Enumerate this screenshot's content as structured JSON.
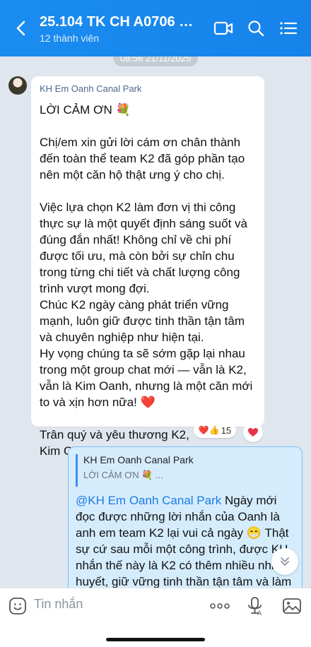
{
  "header": {
    "title": "25.104 TK CH A0706 Ca...",
    "subtitle": "12 thành viên",
    "icons": [
      "back-icon",
      "video-call-icon",
      "search-icon",
      "menu-list-icon"
    ],
    "bg_color": "#1a8cf0"
  },
  "chat": {
    "timestamp": "08:56 21/11/2025",
    "incoming": {
      "sender": "KH Em Oanh Canal Park",
      "text": "LỜI CẢM ƠN 💐\n\nChị/em xin gửi lời cám ơn chân thành đến toàn thể team K2 đã góp phần tạo nên một căn hộ thật ưng ý cho chị.\n\nViệc lựa chọn K2 làm đơn vị thi công thực sự là một quyết định sáng suốt và đúng đắn nhất! Không chỉ về chi phí được tối ưu, mà còn bởi sự chỉn chu trong từng chi tiết và chất lượng công trình vượt mong đợi.\nChúc K2 ngày càng phát triển vững mạnh, luôn giữ được tinh thần tận tâm và chuyên nghiệp như hiện tại.\nHy vọng chúng ta sẽ sớm gặp lại nhau trong một group chat mới — vẫn là K2, vẫn là Kim Oanh, nhưng là một căn mới to và xịn hơn nữa! ❤️\n\nTrân quý và yêu thương K2,\nKim Oanh",
      "reactions_emoji": "❤️👍",
      "reactions_count": "15"
    },
    "outgoing": {
      "quote_name": "KH Em Oanh Canal Park",
      "quote_text": "LỜI CẢM ƠN 💐 ...",
      "mention": "@KH Em Oanh Canal Park",
      "text": " Ngày mới đọc được những lời nhắn của Oanh là anh em team K2 lại vui cả ngày 😁 Thật sự cứ sau mỗi một công trình, được KH nhắn thế này là K2 có thêm nhiều nhiệt huyết, giữ vững tinh thần tận tâm và làm tốt hơn mỗi ngày trong hành trình"
    }
  },
  "input_bar": {
    "placeholder": "Tin nhắn",
    "icons": [
      "emoji-icon",
      "more-icon",
      "voice-icon",
      "image-icon"
    ]
  }
}
